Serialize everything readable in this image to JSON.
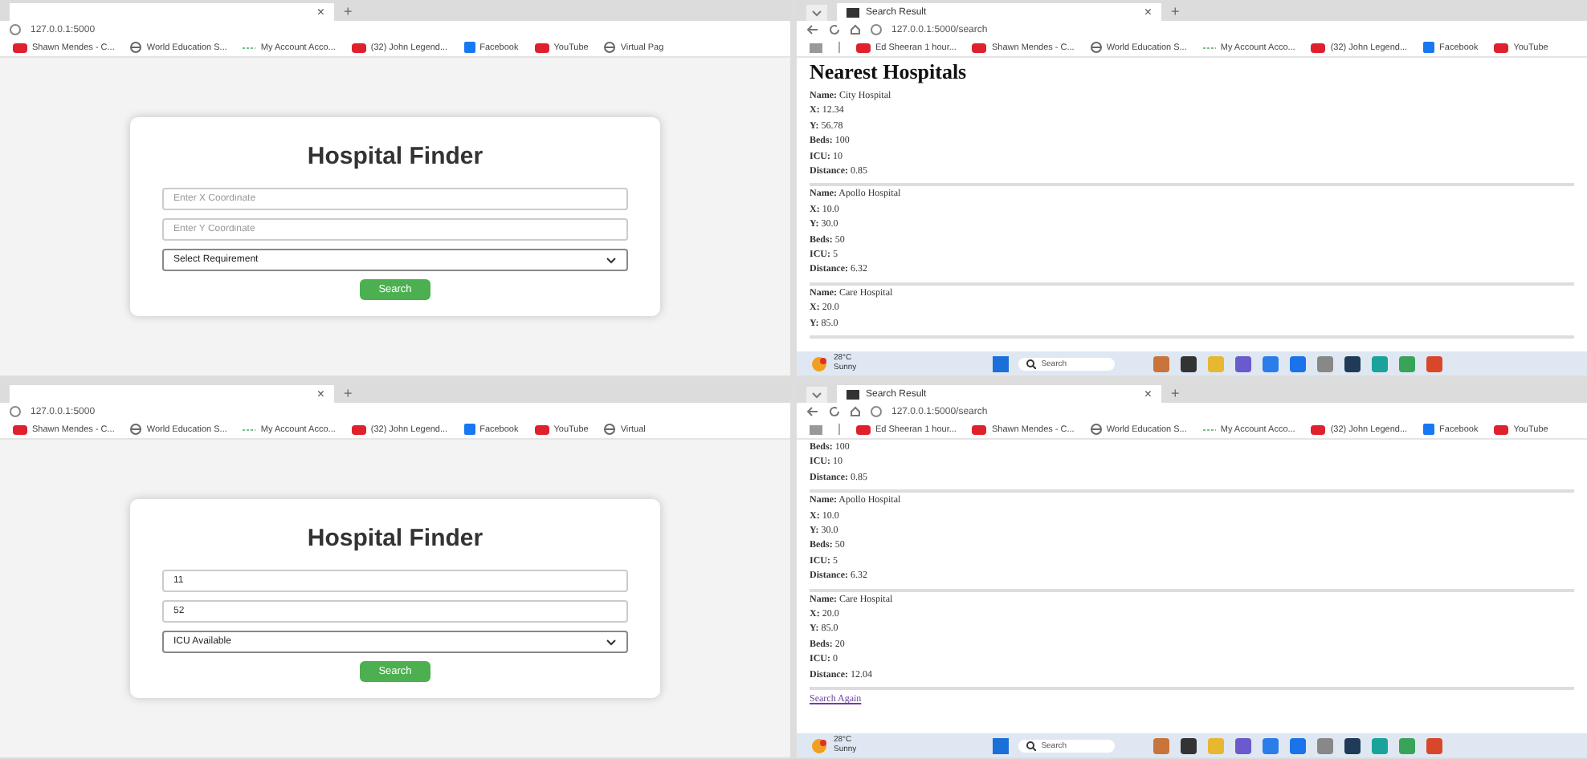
{
  "panels": [
    {
      "kind": "finder",
      "tab_close": "×",
      "new_tab": "+",
      "address": "127.0.0.1:5000",
      "bookmarks": [
        {
          "kind": "video",
          "label": "Shawn Mendes - C..."
        },
        {
          "kind": "globe",
          "label": "World Education S..."
        },
        {
          "kind": "account",
          "label": "My Account Acco..."
        },
        {
          "kind": "video",
          "label": "(32) John Legend..."
        },
        {
          "kind": "facebook",
          "label": "Facebook"
        },
        {
          "kind": "video",
          "label": "YouTube"
        },
        {
          "kind": "globe",
          "label": "Virtual Pag"
        }
      ],
      "form": {
        "title": "Hospital Finder",
        "fields": [
          {
            "placeholder": "Enter X Coordinate"
          },
          {
            "placeholder": "Enter Y Coordinate"
          }
        ],
        "select": "Select Requirement",
        "button": "Search"
      }
    },
    {
      "kind": "results",
      "tab_title": "Search Result",
      "tab_close": "×",
      "new_tab": "+",
      "address": "127.0.0.1:5000/search",
      "bookmarks": [
        {
          "kind": "video",
          "label": "Ed Sheeran 1 hour..."
        },
        {
          "kind": "video",
          "label": "Shawn Mendes - C..."
        },
        {
          "kind": "globe",
          "label": "World Education S..."
        },
        {
          "kind": "account",
          "label": "My Account Acco..."
        },
        {
          "kind": "video",
          "label": "(32) John Legend..."
        },
        {
          "kind": "facebook",
          "label": "Facebook"
        },
        {
          "kind": "video",
          "label": "YouTube"
        }
      ],
      "heading": "Nearest Hospitals",
      "groups": [
        [
          {
            "label": "Name:",
            "value": "City Hospital"
          },
          {
            "label": "X:",
            "value": "12.34"
          },
          {
            "label": "Y:",
            "value": "56.78"
          },
          {
            "label": "Beds:",
            "value": "100"
          },
          {
            "label": "ICU:",
            "value": "10"
          },
          {
            "label": "Distance:",
            "value": "0.85"
          }
        ],
        [
          {
            "label": "Name:",
            "value": "Apollo Hospital"
          },
          {
            "label": "X:",
            "value": "10.0"
          },
          {
            "label": "Y:",
            "value": "30.0"
          },
          {
            "label": "Beds:",
            "value": "50"
          },
          {
            "label": "ICU:",
            "value": "5"
          },
          {
            "label": "Distance:",
            "value": "6.32"
          }
        ],
        [
          {
            "label": "Name:",
            "value": "Care Hospital"
          },
          {
            "label": "X:",
            "value": "20.0"
          },
          {
            "label": "Y:",
            "value": "85.0"
          }
        ]
      ],
      "taskbar": {
        "temperature": "28°C",
        "condition": "Sunny",
        "search": "Search"
      }
    },
    {
      "kind": "finder",
      "tab_close": "×",
      "new_tab": "+",
      "address": "127.0.0.1:5000",
      "bookmarks": [
        {
          "kind": "video",
          "label": "Shawn Mendes - C..."
        },
        {
          "kind": "globe",
          "label": "World Education S..."
        },
        {
          "kind": "account",
          "label": "My Account Acco..."
        },
        {
          "kind": "video",
          "label": "(32) John Legend..."
        },
        {
          "kind": "facebook",
          "label": "Facebook"
        },
        {
          "kind": "video",
          "label": "YouTube"
        },
        {
          "kind": "globe",
          "label": "Virtual"
        }
      ],
      "form": {
        "title": "Hospital Finder",
        "fields": [
          {
            "value": "11"
          },
          {
            "value": "52"
          }
        ],
        "select": "ICU Available",
        "button": "Search"
      }
    },
    {
      "kind": "results",
      "tab_title": "Search Result",
      "tab_close": "×",
      "new_tab": "+",
      "address": "127.0.0.1:5000/search",
      "bookmarks": [
        {
          "kind": "video",
          "label": "Ed Sheeran 1 hour..."
        },
        {
          "kind": "video",
          "label": "Shawn Mendes - C..."
        },
        {
          "kind": "globe",
          "label": "World Education S..."
        },
        {
          "kind": "account",
          "label": "My Account Acco..."
        },
        {
          "kind": "video",
          "label": "(32) John Legend..."
        },
        {
          "kind": "facebook",
          "label": "Facebook"
        },
        {
          "kind": "video",
          "label": "YouTube"
        }
      ],
      "groups": [
        [
          {
            "label": "Beds:",
            "value": "100"
          },
          {
            "label": "ICU:",
            "value": "10"
          },
          {
            "label": "Distance:",
            "value": "0.85"
          }
        ],
        [
          {
            "label": "Name:",
            "value": "Apollo Hospital"
          },
          {
            "label": "X:",
            "value": "10.0"
          },
          {
            "label": "Y:",
            "value": "30.0"
          },
          {
            "label": "Beds:",
            "value": "50"
          },
          {
            "label": "ICU:",
            "value": "5"
          },
          {
            "label": "Distance:",
            "value": "6.32"
          }
        ],
        [
          {
            "label": "Name:",
            "value": "Care Hospital"
          },
          {
            "label": "X:",
            "value": "20.0"
          },
          {
            "label": "Y:",
            "value": "85.0"
          },
          {
            "label": "Beds:",
            "value": "20"
          },
          {
            "label": "ICU:",
            "value": "0"
          },
          {
            "label": "Distance:",
            "value": "12.04"
          }
        ]
      ],
      "link": "Search Again",
      "taskbar": {
        "temperature": "28°C",
        "condition": "Sunny",
        "search": "Search"
      }
    }
  ]
}
